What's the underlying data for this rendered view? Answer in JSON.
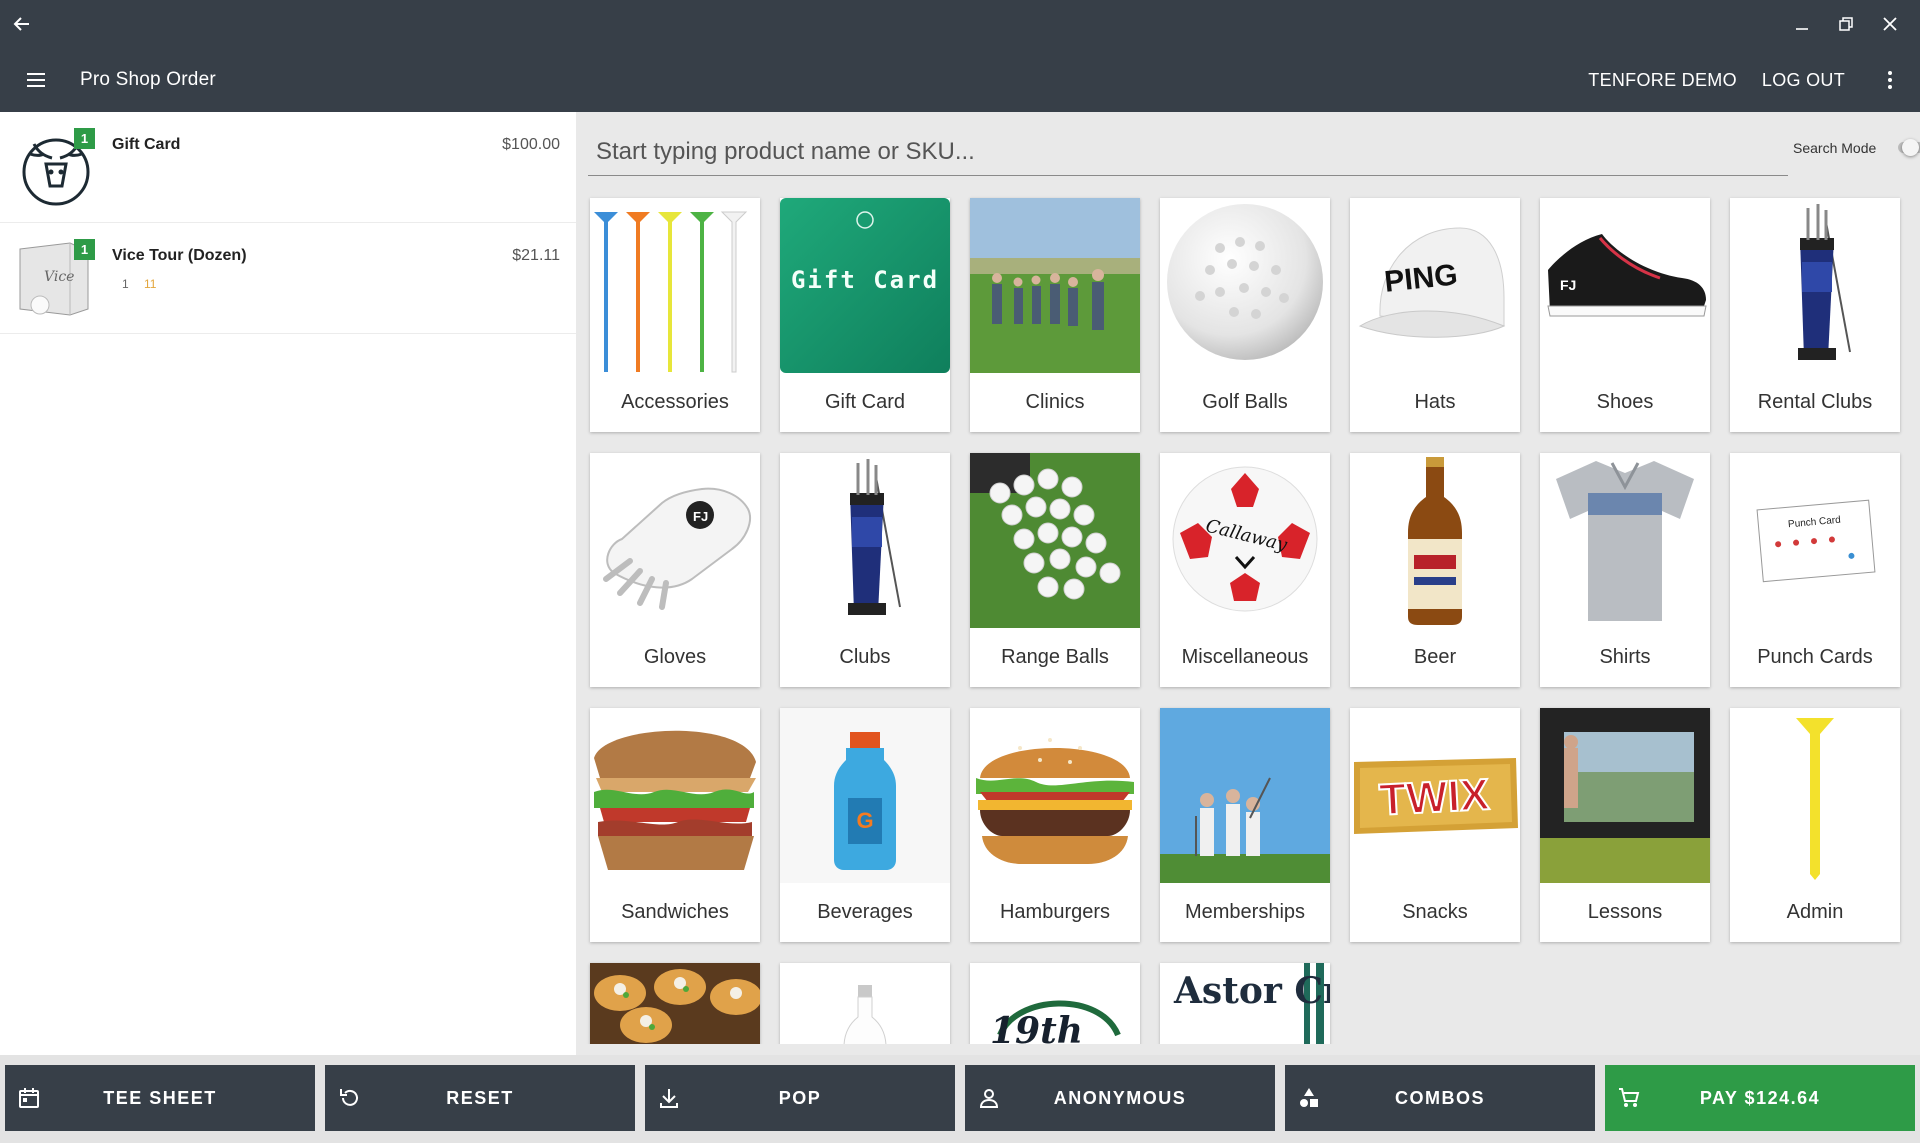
{
  "app": {
    "title": "Pro Shop Order",
    "user": "TENFORE DEMO",
    "logout": "LOG OUT"
  },
  "order": {
    "items": [
      {
        "name": "Gift Card",
        "price": "$100.00",
        "qty": "1"
      },
      {
        "name": "Vice Tour (Dozen)",
        "price": "$21.11",
        "qty": "1",
        "sub_qty": "1",
        "sub_num": "11"
      }
    ]
  },
  "search": {
    "placeholder": "Start typing product name or SKU...",
    "mode_label": "Search Mode",
    "mode_on": false
  },
  "categories": [
    {
      "label": "Accessories",
      "icon": "golf-tees"
    },
    {
      "label": "Gift Card",
      "icon": "gift-card"
    },
    {
      "label": "Clinics",
      "icon": "golf-clinic"
    },
    {
      "label": "Golf Balls",
      "icon": "golf-ball"
    },
    {
      "label": "Hats",
      "icon": "cap",
      "brand": "PING"
    },
    {
      "label": "Shoes",
      "icon": "golf-shoe"
    },
    {
      "label": "Rental Clubs",
      "icon": "golf-bag"
    },
    {
      "label": "Gloves",
      "icon": "golf-glove"
    },
    {
      "label": "Clubs",
      "icon": "golf-bag"
    },
    {
      "label": "Range Balls",
      "icon": "range-balls"
    },
    {
      "label": "Miscellaneous",
      "icon": "soccer-golf-ball",
      "brand": "Callaway"
    },
    {
      "label": "Beer",
      "icon": "beer-bottle"
    },
    {
      "label": "Shirts",
      "icon": "polo-shirt"
    },
    {
      "label": "Punch Cards",
      "icon": "punch-card",
      "card_title": "Punch Card"
    },
    {
      "label": "Sandwiches",
      "icon": "sandwich"
    },
    {
      "label": "Beverages",
      "icon": "sports-drink"
    },
    {
      "label": "Hamburgers",
      "icon": "hamburger"
    },
    {
      "label": "Memberships",
      "icon": "golfers"
    },
    {
      "label": "Snacks",
      "icon": "candy-bar",
      "brand": "TWIX"
    },
    {
      "label": "Lessons",
      "icon": "golf-simulator"
    },
    {
      "label": "Admin",
      "icon": "golf-tee"
    },
    {
      "label": "",
      "icon": "appetizer"
    },
    {
      "label": "",
      "icon": "bottle"
    },
    {
      "label": "",
      "icon": "19th-hole-logo",
      "brand": "19th"
    },
    {
      "label": "",
      "icon": "astor-creek-logo",
      "brand": "Astor Creek"
    }
  ],
  "footer": {
    "tee_sheet": "TEE SHEET",
    "reset": "RESET",
    "pop": "POP",
    "anonymous": "ANONYMOUS",
    "combos": "COMBOS",
    "pay": "PAY $124.64"
  },
  "colors": {
    "appbar": "#373f48",
    "pay": "#2e9b47",
    "badge": "#2e9b47",
    "background": "#e9e9e9"
  }
}
